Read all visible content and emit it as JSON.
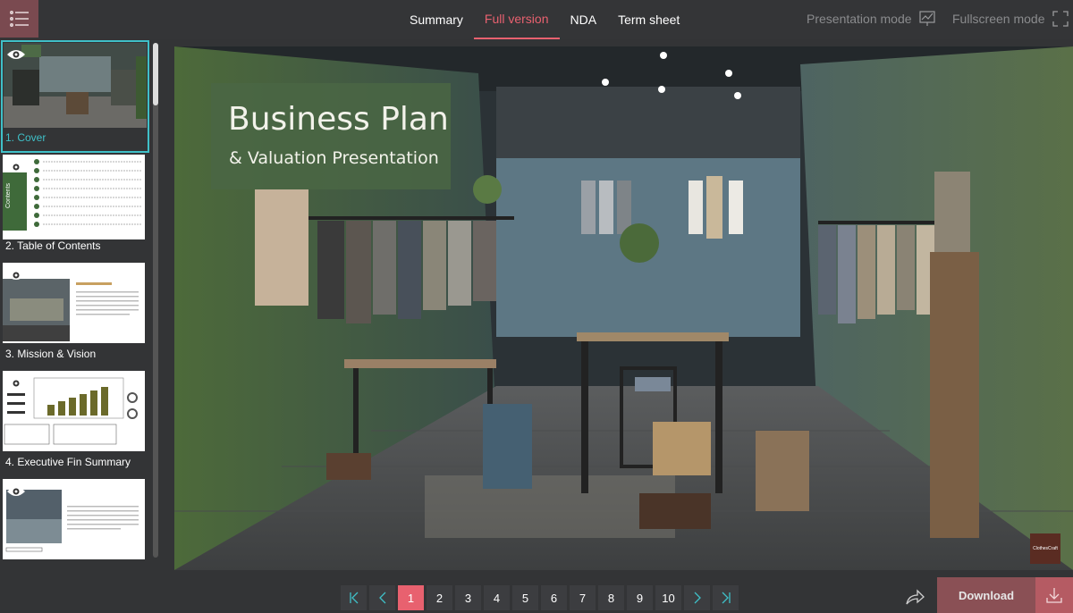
{
  "header": {
    "tabs": [
      {
        "label": "Summary"
      },
      {
        "label": "Full version"
      },
      {
        "label": "NDA"
      },
      {
        "label": "Term sheet"
      }
    ],
    "presentation_mode": "Presentation mode",
    "fullscreen_mode": "Fullscreen mode",
    "active_tab_color": "#e8616f"
  },
  "sidebar": {
    "slides": [
      {
        "label": "1. Cover"
      },
      {
        "label": "2. Table of Contents",
        "side_label": "Contents"
      },
      {
        "label": "3. Mission & Vision"
      },
      {
        "label": "4. Executive Fin Summary"
      },
      {
        "label": ""
      }
    ],
    "active_color": "#3fc0c8"
  },
  "slide": {
    "title": "Business Plan",
    "subtitle": "& Valuation Presentation",
    "logo_text": "ClothesCraft"
  },
  "pager": {
    "pages": [
      "1",
      "2",
      "3",
      "4",
      "5",
      "6",
      "7",
      "8",
      "9",
      "10"
    ],
    "current": "1"
  },
  "footer": {
    "download_label": "Download"
  }
}
